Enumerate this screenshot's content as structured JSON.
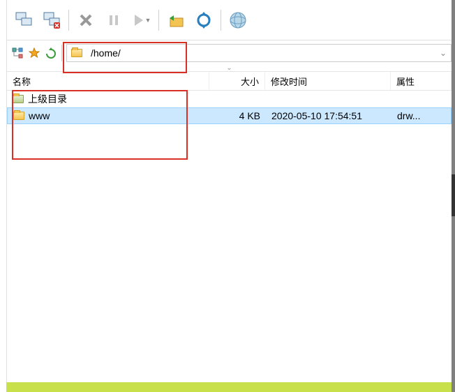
{
  "addressbar": {
    "path": "/home/"
  },
  "columns": {
    "name": "名称",
    "size": "大小",
    "modified": "修改时间",
    "attr": "属性"
  },
  "rows": {
    "parent": {
      "label": "上级目录"
    },
    "items": [
      {
        "name": "www",
        "size": "4 KB",
        "modified": "2020-05-10 17:54:51",
        "attr": "drw..."
      }
    ]
  }
}
